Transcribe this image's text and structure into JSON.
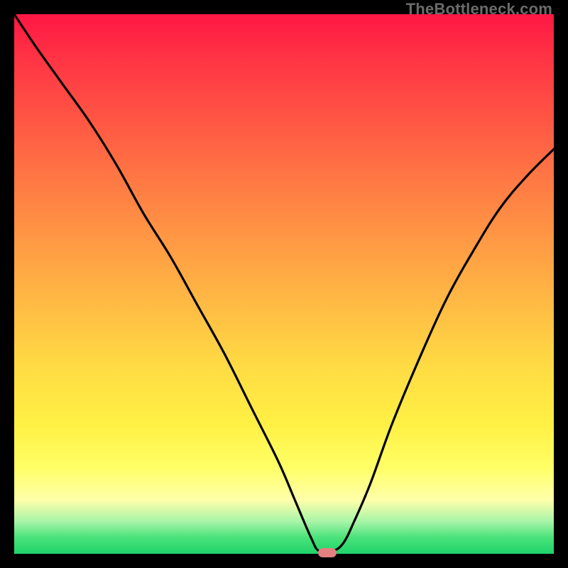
{
  "watermark": "TheBottleneck.com",
  "colors": {
    "background": "#000000",
    "curve_stroke": "#000000",
    "marker": "#e48080"
  },
  "chart_data": {
    "type": "line",
    "title": "",
    "xlabel": "",
    "ylabel": "",
    "xlim": [
      0,
      100
    ],
    "ylim": [
      0,
      100
    ],
    "gradient_stops": [
      {
        "pos": 0,
        "color": "#ff1744"
      },
      {
        "pos": 8,
        "color": "#ff3344"
      },
      {
        "pos": 18,
        "color": "#ff5144"
      },
      {
        "pos": 30,
        "color": "#ff7644"
      },
      {
        "pos": 42,
        "color": "#ff9944"
      },
      {
        "pos": 54,
        "color": "#ffbb44"
      },
      {
        "pos": 66,
        "color": "#ffdd44"
      },
      {
        "pos": 76,
        "color": "#fff044"
      },
      {
        "pos": 84,
        "color": "#ffff66"
      },
      {
        "pos": 90,
        "color": "#ffffaa"
      },
      {
        "pos": 94,
        "color": "#a8f5a8"
      },
      {
        "pos": 97,
        "color": "#4ae27a"
      },
      {
        "pos": 100,
        "color": "#1fd46a"
      }
    ],
    "series": [
      {
        "name": "bottleneck-curve",
        "x": [
          0,
          4,
          9,
          14,
          19,
          24,
          29,
          34,
          39,
          44,
          49,
          52,
          55,
          56.5,
          59,
          61,
          63,
          66,
          70,
          75,
          80,
          85,
          90,
          95,
          100
        ],
        "y": [
          100,
          94,
          87,
          80,
          72,
          63,
          55,
          46,
          37,
          27,
          17,
          10,
          3,
          0.5,
          0.5,
          2,
          6,
          13,
          24,
          36,
          47,
          56,
          64,
          70,
          75
        ]
      }
    ],
    "marker": {
      "x": 58,
      "y": 0,
      "color": "#e48080"
    }
  }
}
